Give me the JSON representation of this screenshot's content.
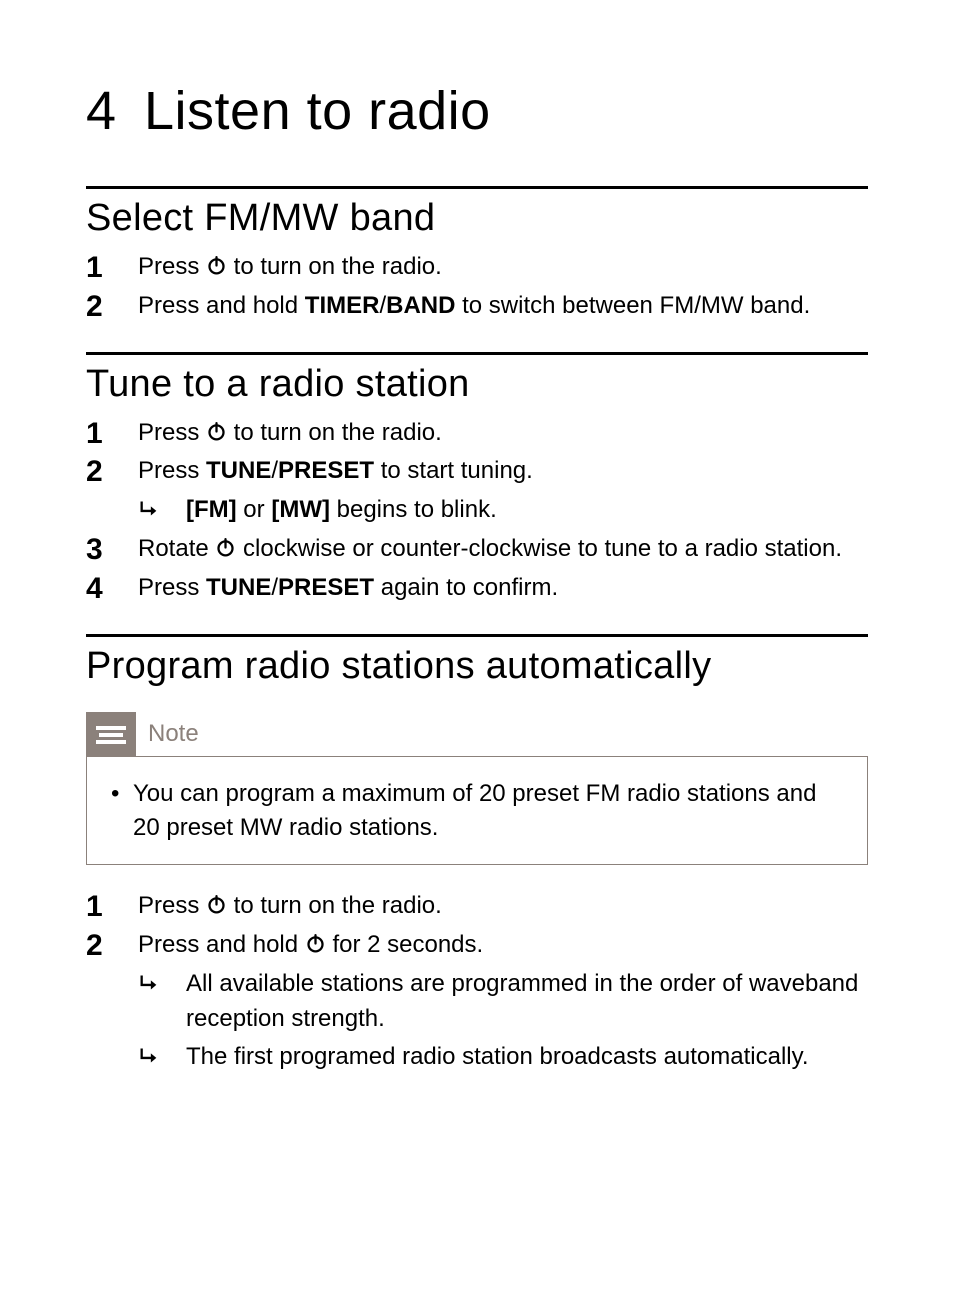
{
  "chapter": {
    "number": "4",
    "title": "Listen to radio"
  },
  "sections": [
    {
      "title": "Select FM/MW band",
      "steps": [
        {
          "t1": "Press ",
          "icon": "power",
          "t2": " to turn on the radio."
        },
        {
          "t1": "Press and hold ",
          "bold1": "TIMER",
          "sep": "/",
          "bold2": "BAND",
          "t2": " to switch between FM/MW band."
        }
      ]
    },
    {
      "title": "Tune to a radio station",
      "steps": [
        {
          "t1": "Press ",
          "icon": "power",
          "t2": " to turn on the radio."
        },
        {
          "t1": "Press ",
          "bold1": "TUNE",
          "sep": "/",
          "bold2": "PRESET",
          "t2": " to start tuning.",
          "subs": [
            {
              "b1": "[FM]",
              "m": " or ",
              "b2": "[MW]",
              "t": " begins to blink."
            }
          ]
        },
        {
          "t1": "Rotate ",
          "icon": "power",
          "t2": " clockwise or counter-clockwise to tune to a radio station."
        },
        {
          "t1": "Press ",
          "bold1": "TUNE",
          "sep": "/",
          "bold2": "PRESET",
          "t2": " again to confirm."
        }
      ]
    },
    {
      "title": "Program radio stations automatically",
      "note": {
        "label": "Note",
        "items": [
          "You can program a maximum of 20 preset FM radio stations and 20 preset MW radio stations."
        ]
      },
      "steps": [
        {
          "t1": "Press ",
          "icon": "power",
          "t2": " to turn on the radio."
        },
        {
          "t1": "Press and hold ",
          "icon": "power",
          "t2": " for 2 seconds.",
          "subs": [
            {
              "t": "All available stations are programmed in the order of waveband reception strength."
            },
            {
              "t": "The first programed radio station broadcasts automatically."
            }
          ]
        }
      ]
    }
  ]
}
